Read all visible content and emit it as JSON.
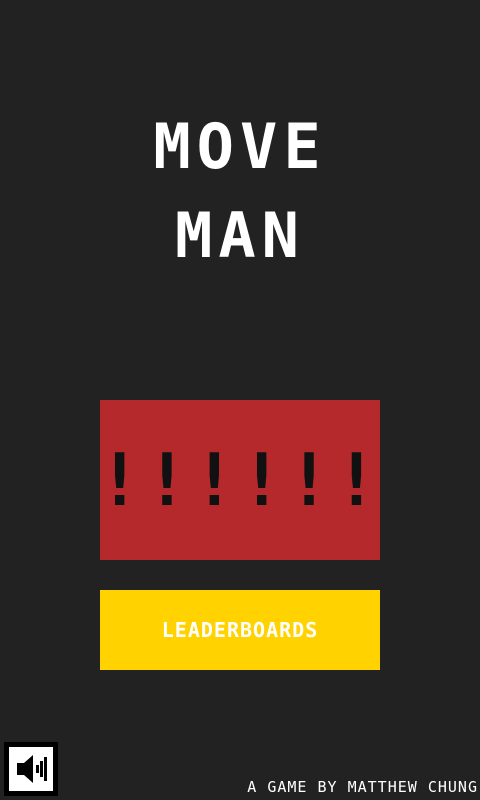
{
  "title": {
    "line1": "MOVE",
    "line2": "MAN"
  },
  "play_button": {
    "label": "!!!!!!"
  },
  "leaderboards_button": {
    "label": "LEADERBOARDS"
  },
  "sound_toggle": {
    "icon": "speaker-icon"
  },
  "credit": "A GAME BY MATTHEW CHUNG",
  "colors": {
    "background": "#222222",
    "play_button": "#b5282c",
    "leaderboards_button": "#ffd200",
    "text": "#ffffff"
  }
}
